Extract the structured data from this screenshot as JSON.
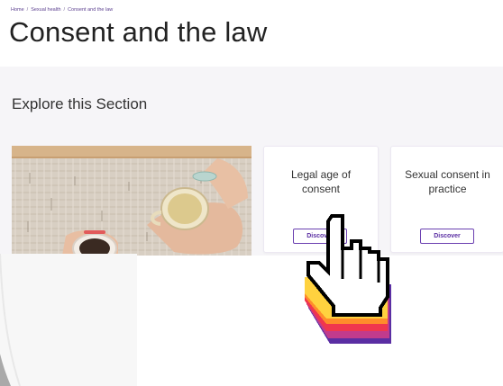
{
  "breadcrumb": {
    "home": "Home",
    "section": "Sexual health",
    "current": "Consent and the law",
    "separator": "/"
  },
  "page": {
    "title": "Consent and the law"
  },
  "explore": {
    "heading": "Explore this Section",
    "cards": [
      {
        "title": "Legal age of consent",
        "button_label": "Discover"
      },
      {
        "title": "Sexual consent in practice",
        "button_label": "Discover"
      }
    ]
  },
  "colors": {
    "brand_purple": "#5a2ea3",
    "section_background": "#f6f5f8",
    "cursor_gradient": [
      "#ffd23f",
      "#ff8c2b",
      "#f0364e",
      "#c13b8c",
      "#5a2ea3"
    ]
  },
  "cursor": {
    "icon": "pointing-hand-cursor-icon"
  }
}
